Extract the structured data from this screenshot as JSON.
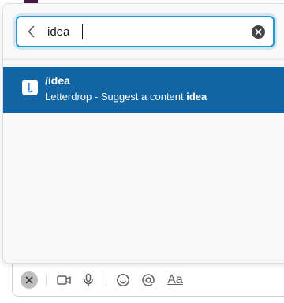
{
  "search": {
    "query": "idea",
    "placeholder": ""
  },
  "result": {
    "command": "/idea",
    "app_name": "Letterdrop",
    "separator": " - ",
    "desc_prefix": "Suggest a content ",
    "desc_highlight": "idea"
  },
  "composer": {
    "format_label": "Aa"
  },
  "colors": {
    "selection": "#1264a3",
    "focus_ring": "#1d9bd1",
    "brand_purple": "#4a154b"
  }
}
